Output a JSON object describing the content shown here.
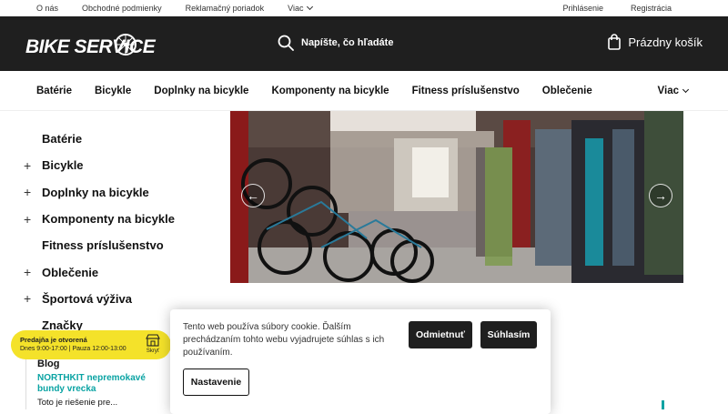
{
  "topbar": {
    "links": [
      "O nás",
      "Obchodné podmienky",
      "Reklamačný poriadok"
    ],
    "more": "Viac",
    "login": "Prihlásenie",
    "register": "Registrácia"
  },
  "header": {
    "logo": "BIKE SERVICE",
    "search_placeholder": "Napíšte, čo hľadáte",
    "cart": "Prázdny košík"
  },
  "nav": {
    "items": [
      "Batérie",
      "Bicykle",
      "Doplnky na bicykle",
      "Komponenty na bicykle",
      "Fitness príslušenstvo",
      "Oblečenie"
    ],
    "more": "Viac"
  },
  "sidebar": {
    "categories": [
      {
        "label": "Batérie",
        "expandable": false
      },
      {
        "label": "Bicykle",
        "expandable": true
      },
      {
        "label": "Doplnky na bicykle",
        "expandable": true
      },
      {
        "label": "Komponenty na bicykle",
        "expandable": true
      },
      {
        "label": "Fitness príslušenstvo",
        "expandable": false
      },
      {
        "label": "Oblečenie",
        "expandable": true
      },
      {
        "label": "Športová výživa",
        "expandable": true
      },
      {
        "label": "Značky",
        "expandable": false
      }
    ]
  },
  "hours": {
    "status": "Predajňa je otvorená",
    "times": "Dnes 9:00-17:00 | Pauza 12:00-13:00",
    "label": "Skryť"
  },
  "blog": {
    "heading": "Blog",
    "article_title": "NORTHKIT nepremokavé bundy vrecka",
    "article_excerpt": "Toto je riešenie pre..."
  },
  "cookie": {
    "text": "Tento web používa súbory cookie. Ďalším prechádzaním tohto webu vyjadrujete súhlas s ich používaním.",
    "decline": "Odmietnuť",
    "accept": "Súhlasím",
    "settings": "Nastavenie"
  },
  "colors": {
    "header_bg": "#1f1f1f",
    "accent_teal": "#0aa3a3",
    "hours_yellow": "#f4e22a"
  }
}
